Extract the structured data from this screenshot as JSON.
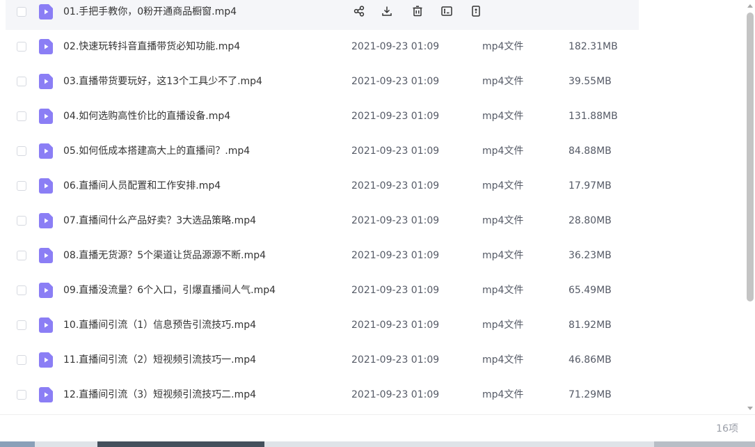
{
  "files": [
    {
      "name": "01.手把手教你，0粉开通商品橱窗.mp4",
      "date": "",
      "type": "",
      "size": ""
    },
    {
      "name": "02.快速玩转抖音直播带货必知功能.mp4",
      "date": "2021-09-23 01:09",
      "type": "mp4文件",
      "size": "182.31MB"
    },
    {
      "name": "03.直播带货要玩好，这13个工具少不了.mp4",
      "date": "2021-09-23 01:09",
      "type": "mp4文件",
      "size": "39.55MB"
    },
    {
      "name": "04.如何选购高性价比的直播设备.mp4",
      "date": "2021-09-23 01:09",
      "type": "mp4文件",
      "size": "131.88MB"
    },
    {
      "name": "05.如何低成本搭建高大上的直播间？.mp4",
      "date": "2021-09-23 01:09",
      "type": "mp4文件",
      "size": "84.88MB"
    },
    {
      "name": "06.直播间人员配置和工作安排.mp4",
      "date": "2021-09-23 01:09",
      "type": "mp4文件",
      "size": "17.97MB"
    },
    {
      "name": "07.直播间什么产品好卖？3大选品策略.mp4",
      "date": "2021-09-23 01:09",
      "type": "mp4文件",
      "size": "28.80MB"
    },
    {
      "name": "08.直播无货源？5个渠道让货品源源不断.mp4",
      "date": "2021-09-23 01:09",
      "type": "mp4文件",
      "size": "36.23MB"
    },
    {
      "name": "09.直播没流量？6个入口，引爆直播间人气.mp4",
      "date": "2021-09-23 01:09",
      "type": "mp4文件",
      "size": "65.49MB"
    },
    {
      "name": "10.直播间引流（1）信息预告引流技巧.mp4",
      "date": "2021-09-23 01:09",
      "type": "mp4文件",
      "size": "81.92MB"
    },
    {
      "name": "11.直播间引流（2）短视频引流技巧一.mp4",
      "date": "2021-09-23 01:09",
      "type": "mp4文件",
      "size": "46.86MB"
    },
    {
      "name": "12.直播间引流（3）短视频引流技巧二.mp4",
      "date": "2021-09-23 01:09",
      "type": "mp4文件",
      "size": "71.29MB"
    }
  ],
  "row_actions": [
    "share-icon",
    "download-icon",
    "delete-icon",
    "rename-icon",
    "more-icon"
  ],
  "footer": {
    "count": "16项"
  },
  "colors": {
    "file_icon": "#8b7ef5",
    "hover_row": "#f5f6f9",
    "action_icon": "#333333",
    "muted_text": "#9a9ea8"
  }
}
